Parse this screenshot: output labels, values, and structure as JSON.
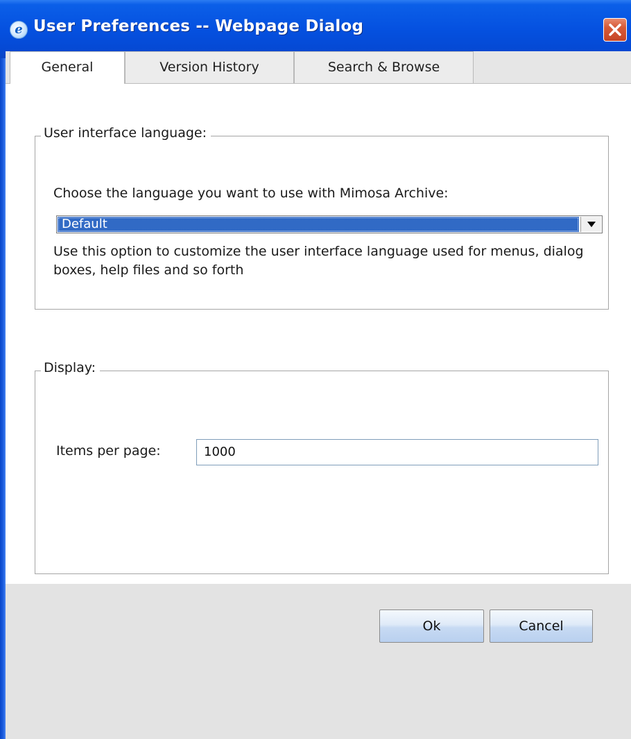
{
  "window": {
    "title": "User Preferences -- Webpage Dialog",
    "icon": "ie-icon",
    "icon_glyph": "e",
    "close": "close-icon"
  },
  "tabs": [
    {
      "label": "General",
      "active": true
    },
    {
      "label": "Version History",
      "active": false
    },
    {
      "label": "Search & Browse",
      "active": false
    }
  ],
  "language_group": {
    "legend": "User interface language:",
    "prompt": "Choose the language you want to use with Mimosa Archive:",
    "select_value": "Default",
    "help": "Use this option to customize the user interface language used for menus, dialog boxes, help files and so forth"
  },
  "display_group": {
    "legend": "Display:",
    "items_label": "Items per page:",
    "items_value": "1000"
  },
  "buttons": {
    "ok": "Ok",
    "cancel": "Cancel"
  },
  "colors": {
    "titlebar": "#0551e0",
    "selection": "#316ac5",
    "close": "#d65a38",
    "footer": "#e3e3e3"
  }
}
